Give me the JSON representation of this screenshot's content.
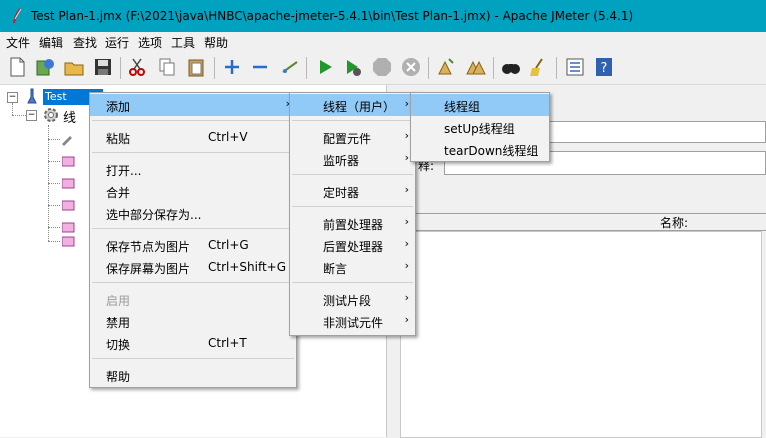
{
  "window": {
    "title": "Test Plan-1.jmx (F:\\2021\\java\\HNBC\\apache-jmeter-5.4.1\\bin\\Test Plan-1.jmx) - Apache JMeter (5.4.1)"
  },
  "menubar": {
    "items": [
      "文件",
      "编辑",
      "查找",
      "运行",
      "选项",
      "工具",
      "帮助"
    ]
  },
  "toolbar": {
    "buttons": [
      "new-icon",
      "templates-icon",
      "open-icon",
      "save-icon",
      "cut-icon",
      "copy-icon",
      "paste-icon",
      "expand-icon",
      "collapse-icon",
      "toggle-icon",
      "start-icon",
      "start-no-pause-icon",
      "stop-icon",
      "shutdown-icon",
      "clear-icon",
      "clear-all-icon",
      "search-icon",
      "reset-search-icon",
      "function-helper-icon",
      "help-icon"
    ]
  },
  "tree": {
    "root_label": "Test",
    "child_label": "线"
  },
  "right_panel": {
    "name_label": "名称:",
    "comment_label": "释:"
  },
  "context_menu": {
    "items": {
      "add": "添加",
      "paste": "粘贴",
      "paste_shortcut": "Ctrl+V",
      "open": "打开...",
      "merge": "合并",
      "save_selection": "选中部分保存为...",
      "save_node_image": "保存节点为图片",
      "save_node_image_shortcut": "Ctrl+G",
      "save_screen_image": "保存屏幕为图片",
      "save_screen_image_shortcut": "Ctrl+Shift+G",
      "enable": "启用",
      "disable": "禁用",
      "toggle": "切换",
      "toggle_shortcut": "Ctrl+T",
      "help": "帮助"
    }
  },
  "add_submenu": {
    "threads": "线程（用户）",
    "config": "配置元件",
    "listener": "监听器",
    "timer": "定时器",
    "pre": "前置处理器",
    "post": "后置处理器",
    "assertion": "断言",
    "fragment": "测试片段",
    "non_test": "非测试元件"
  },
  "threads_submenu": {
    "thread_group": "线程组",
    "setup": "setUp线程组",
    "teardown": "tearDown线程组"
  },
  "colors": {
    "titlebar": "#00a2c0",
    "highlight": "#91c9f7",
    "tree_selection": "#0078d7"
  }
}
